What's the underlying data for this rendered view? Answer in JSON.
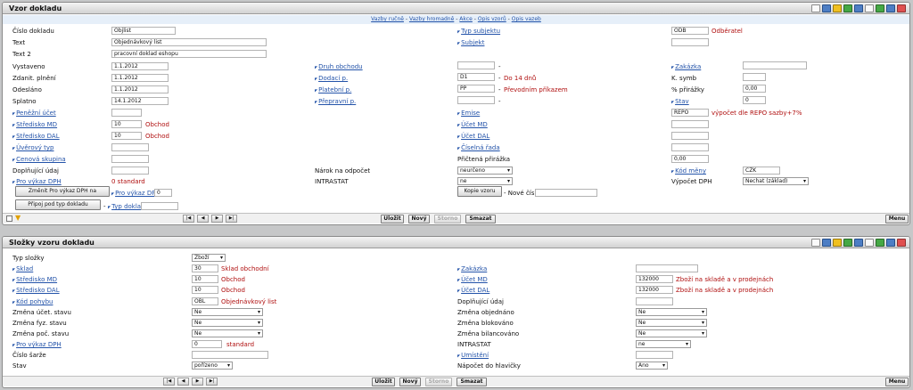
{
  "panel1": {
    "title": "Vzor dokladu",
    "links": [
      "Vazby ručně",
      "Vazby hromadně",
      "Akce",
      "Opis vzorů",
      "Opis vazeb"
    ],
    "fields": {
      "cislo_dokladu": {
        "label": "Číslo dokladu",
        "value": "Objlist"
      },
      "text": {
        "label": "Text",
        "value": "Objednávkový list"
      },
      "text2": {
        "label": "Text 2",
        "value": "pracovní doklad eshopu"
      },
      "vystaveno": {
        "label": "Vystaveno",
        "value": "1.1.2012"
      },
      "zdanit": {
        "label": "Zdanit. plnění",
        "value": "1.1.2012"
      },
      "odeslano": {
        "label": "Odesláno",
        "value": "1.1.2012"
      },
      "splatno": {
        "label": "Splatno",
        "value": "14.1.2012"
      },
      "penezni_ucet": {
        "label": "Peněžní účet",
        "value": ""
      },
      "stredisko_md": {
        "label": "Středisko MD",
        "value": "10",
        "desc": "Obchod"
      },
      "stredisko_dal": {
        "label": "Středisko DAL",
        "value": "10",
        "desc": "Obchod"
      },
      "uverovy_typ": {
        "label": "Úvěrový typ",
        "value": ""
      },
      "cenova_skupina": {
        "label": "Cenová skupina",
        "value": ""
      },
      "doplnujici_udaj": {
        "label": "Doplňující údaj",
        "value": ""
      },
      "pro_vykaz_dph": {
        "label": "Pro výkaz DPH",
        "value": "0 standard"
      },
      "typ_subjektu": {
        "label": "Typ subjektu",
        "value": "ODB",
        "desc": "Odběratel"
      },
      "subjekt": {
        "label": "Subjekt",
        "value": ""
      },
      "druh_obchodu": {
        "label": "Druh obchodu",
        "value": "",
        "dash": "-"
      },
      "dodaci_p": {
        "label": "Dodací p.",
        "value": "D1",
        "desc": "Do 14 dnů",
        "dash": "-"
      },
      "platebni_p": {
        "label": "Platební p.",
        "value": "PP",
        "desc": "Převodním příkazem",
        "dash": "-"
      },
      "prepravni_p": {
        "label": "Přepravní p.",
        "value": "",
        "dash": "-"
      },
      "emise": {
        "label": "Emise",
        "value": "REPO",
        "desc": "výpočet dle REPO sazby+7%"
      },
      "ucet_md": {
        "label": "Účet MD",
        "value": ""
      },
      "ucet_dal": {
        "label": "Účet DAL",
        "value": ""
      },
      "ciselna_rada": {
        "label": "Číselná řada",
        "value": ""
      },
      "prictena_prirazka": {
        "label": "Přičtená přirážka",
        "value": "0,00"
      },
      "narok_odpocet": {
        "label": "Nárok na odpočet",
        "value": "neurčeno"
      },
      "intrastat": {
        "label": "INTRASTAT",
        "value": "ne"
      },
      "zakazka": {
        "label": "Zakázka",
        "value": ""
      },
      "k_symb": {
        "label": "K. symb",
        "value": ""
      },
      "prirazka": {
        "label": "% přirážky",
        "value": "0,00"
      },
      "stav": {
        "label": "Stav",
        "value": "0"
      },
      "kod_meny": {
        "label": "Kód měny",
        "value": "CZK"
      },
      "vypocet_dph": {
        "label": "Výpočet DPH",
        "value": "Nechat (základ)"
      }
    },
    "zmenit_btn": "Změnit Pro výkaz DPH na",
    "pro_vykaz_dph_link": "Pro výkaz DPH",
    "pro_vykaz_dph_new": "0",
    "pripoj_btn": "Připoj pod typ dokladu",
    "typ_dokladu_link": "Typ dokladu",
    "kopie_btn": "Kopie vzoru",
    "nove_cislo_label": "- Nové číslo"
  },
  "panel2": {
    "title": "Složky vzoru dokladu",
    "fields": {
      "typ_slozky": {
        "label": "Typ složky",
        "value": "Zboží"
      },
      "sklad": {
        "label": "Sklad",
        "value": "30",
        "desc": "Sklad obchodní"
      },
      "stredisko_md": {
        "label": "Středisko MD",
        "value": "10",
        "desc": "Obchod"
      },
      "stredisko_dal": {
        "label": "Středisko DAL",
        "value": "10",
        "desc": "Obchod"
      },
      "kod_pohybu": {
        "label": "Kód pohybu",
        "value": "OBL",
        "desc": "Objednávkový list"
      },
      "zmena_ucet": {
        "label": "Změna účet. stavu",
        "value": "Ne"
      },
      "zmena_fyz": {
        "label": "Změna fyz. stavu",
        "value": "Ne"
      },
      "zmena_poc": {
        "label": "Změna poč. stavu",
        "value": "Ne"
      },
      "pro_vykaz_dph": {
        "label": "Pro výkaz DPH",
        "value": "0",
        "desc": "standard"
      },
      "cislo_sarze": {
        "label": "Číslo šarže",
        "value": ""
      },
      "stav": {
        "label": "Stav",
        "value": "pořízeno"
      },
      "zakazka": {
        "label": "Zakázka",
        "value": ""
      },
      "ucet_md": {
        "label": "Účet MD",
        "value": "132000",
        "desc": "Zboží na skladě a v prodejnách"
      },
      "ucet_dal": {
        "label": "Účet DAL",
        "value": "132000",
        "desc": "Zboží na skladě a v prodejnách"
      },
      "doplnujici_udaj": {
        "label": "Doplňující údaj",
        "value": ""
      },
      "zmena_objednano": {
        "label": "Změna objednáno",
        "value": "Ne"
      },
      "zmena_blokovano": {
        "label": "Změna blokováno",
        "value": "Ne"
      },
      "zmena_bilancovano": {
        "label": "Změna bilancováno",
        "value": "Ne"
      },
      "intrastat": {
        "label": "INTRASTAT",
        "value": "ne"
      },
      "umisteni": {
        "label": "Umístění",
        "value": ""
      },
      "napocet": {
        "label": "Nápočet do hlavičky",
        "value": "Ano"
      }
    }
  },
  "footer": {
    "ulozit": "Uložit",
    "novy": "Nový",
    "storno": "Storno",
    "smazat": "Smazat",
    "menu": "Menu"
  }
}
